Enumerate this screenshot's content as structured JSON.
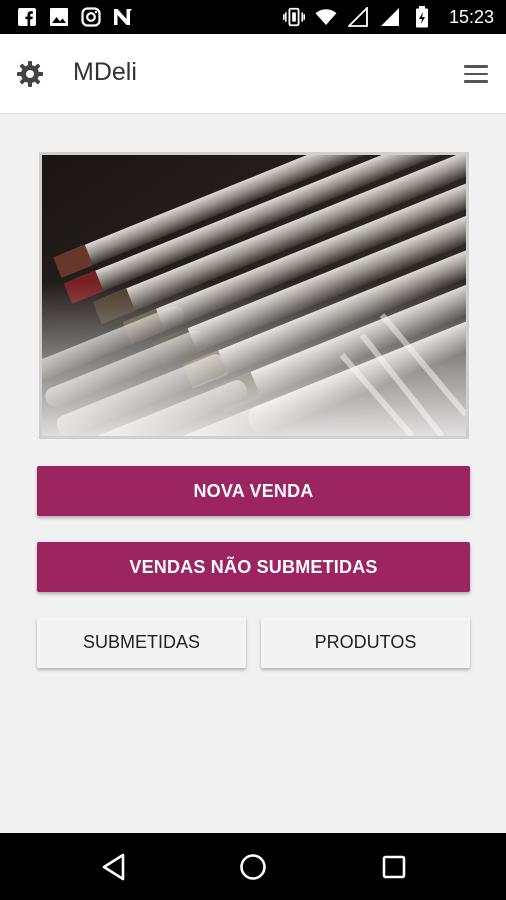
{
  "status_bar": {
    "time": "15:23",
    "left_icons": [
      "facebook-icon",
      "image-icon",
      "instagram-icon",
      "n-app-icon"
    ],
    "right_icons": [
      "vibrate-icon",
      "wifi-icon",
      "signal-icon",
      "signal-full-icon",
      "battery-icon"
    ]
  },
  "app_bar": {
    "title": "MDeli",
    "left_icon": "gear-icon",
    "right_icon": "hamburger-menu-icon"
  },
  "hero": {
    "image": "wine-bottles-photo"
  },
  "buttons": {
    "nova_venda": "NOVA VENDA",
    "vendas_nao_submetidas": "VENDAS NÃO SUBMETIDAS",
    "submetidas": "SUBMETIDAS",
    "produtos": "PRODUTOS"
  },
  "colors": {
    "primary": "#9c2461",
    "background": "#f2f1f2",
    "secondary_button": "#f3f3f3"
  },
  "nav_bar": {
    "icons": [
      "back-icon",
      "home-icon",
      "recent-apps-icon"
    ]
  }
}
